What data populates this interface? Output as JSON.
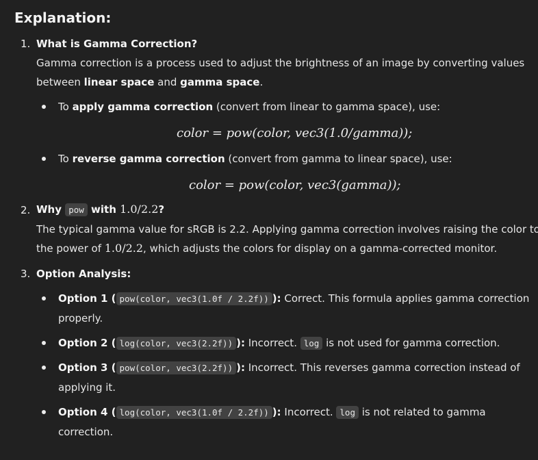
{
  "heading": "Explanation:",
  "items": [
    {
      "num": "1.",
      "title": "What is Gamma Correction?",
      "p1_a": "Gamma correction is a process used to adjust the brightness of an image by converting values",
      "p1_b": "between ",
      "p1_c": "linear space",
      "p1_d": " and ",
      "p1_e": "gamma space",
      "p1_f": ".",
      "bullets": [
        {
          "pre": "To ",
          "bold": "apply gamma correction",
          "post": " (convert from linear to gamma space), use:",
          "formula": "color = pow(color, vec3(1.0/gamma));"
        },
        {
          "pre": "To ",
          "bold": "reverse gamma correction",
          "post": " (convert from gamma to linear space), use:",
          "formula": "color = pow(color, vec3(gamma));"
        }
      ]
    },
    {
      "num": "2.",
      "title_a": "Why ",
      "title_code": "pow",
      "title_b": " with ",
      "title_math": "1.0/2.2",
      "title_c": "?",
      "p_a": "The typical gamma value for sRGB is 2.2. Applying gamma correction involves raising the color to",
      "p_b": "the power of ",
      "p_math": "1.0/2.2",
      "p_c": ", which adjusts the colors for display on a gamma-corrected monitor."
    },
    {
      "num": "3.",
      "title": "Option Analysis:",
      "options": [
        {
          "label": "Option 1",
          "open": " (",
          "code": "pow(color, vec3(1.0f / 2.2f))",
          "close": "):",
          "rest": " Correct. This formula applies gamma correction",
          "rest2": "properly."
        },
        {
          "label": "Option 2",
          "open": " (",
          "code": "log(color, vec3(2.2f))",
          "close": "):",
          "rest": " Incorrect. ",
          "code2": "log",
          "rest_b": " is not used for gamma correction."
        },
        {
          "label": "Option 3",
          "open": " (",
          "code": "pow(color, vec3(2.2f))",
          "close": "):",
          "rest": " Incorrect. This reverses gamma correction instead of",
          "rest2": "applying it."
        },
        {
          "label": "Option 4",
          "open": " (",
          "code": "log(color, vec3(1.0f / 2.2f))",
          "close": "):",
          "rest": " Incorrect. ",
          "code2": "log",
          "rest_b": " is not related to gamma",
          "rest2": "correction."
        }
      ]
    }
  ]
}
